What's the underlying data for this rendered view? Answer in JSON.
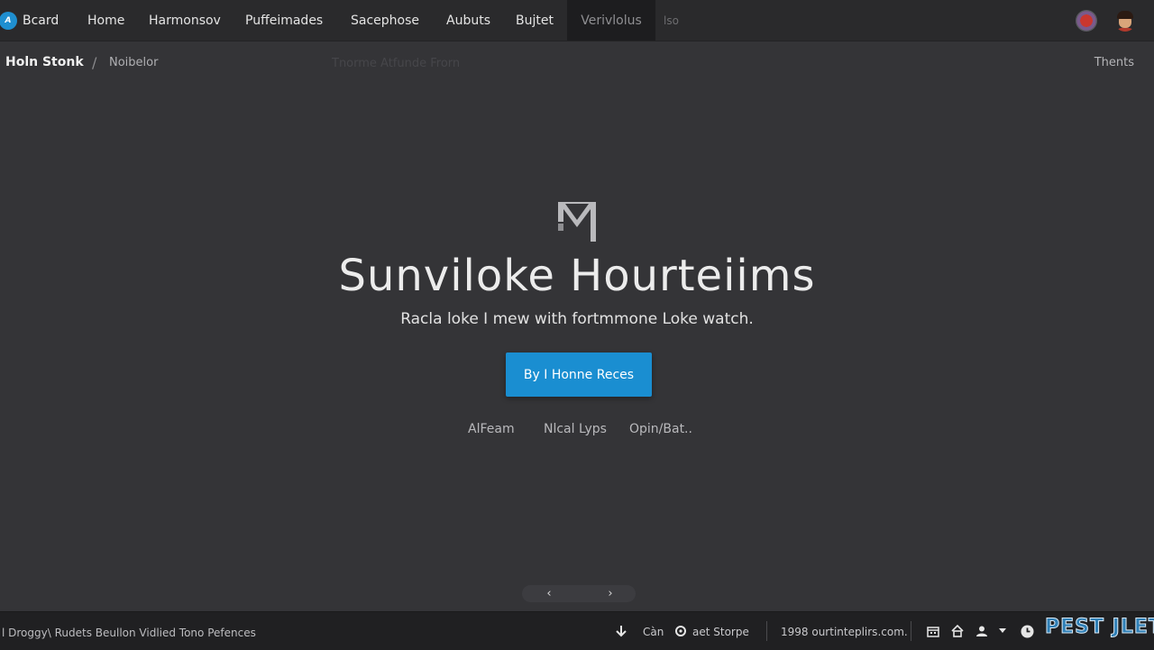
{
  "nav": {
    "brand_label": "Bcard",
    "brand_icon_text": "A",
    "items": [
      "Home",
      "Harmonsov",
      "Puffeimades",
      "Sacephose",
      "Aubuts",
      "Bujtet"
    ],
    "active_item": "Verivlolus",
    "faded_item": "lso"
  },
  "breadcrumb": {
    "root": "Holn Stonk",
    "separator": "/",
    "current": "Noibelor",
    "faded": "Tnorme Atfunde Frorn",
    "themes": "Thents"
  },
  "hero": {
    "title": "Sunviloke Hourteiims",
    "subtitle": "Racla loke I mew with fortmmone Loke watch.",
    "cta_label": "By I Honne Reces",
    "links": [
      "AlFeam",
      "Nlcal Lyps",
      "Opin/Bat.."
    ]
  },
  "pager": {
    "prev": "‹",
    "next": "›"
  },
  "footer": {
    "status_text": "l Droggy\\ Rudets Beullon Vidlied Tono Pefences",
    "download_label": "",
    "item_can": "Càn",
    "item_storpe": "aet Storpe",
    "url_text": "1998 ourtinteplirs.com.",
    "watermark": "PEST JLET"
  },
  "colors": {
    "accent": "#1a8ed1",
    "background": "#343437",
    "topbar": "#2a2a2c",
    "statusbar": "#202022"
  }
}
